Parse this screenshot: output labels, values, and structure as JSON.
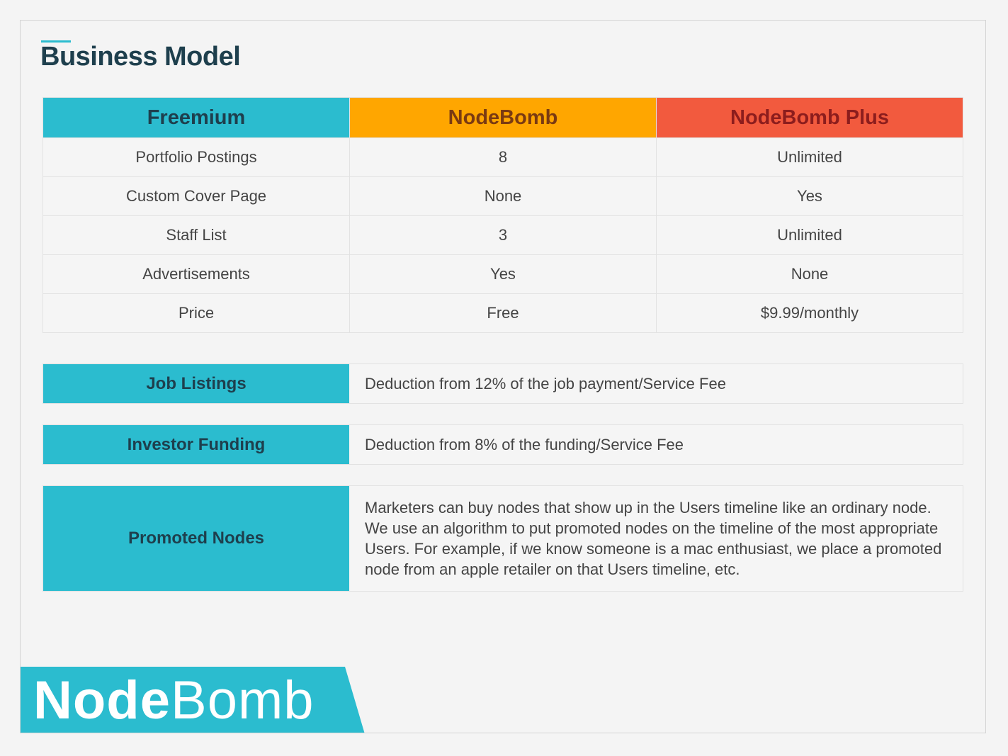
{
  "slide": {
    "title": "Business Model"
  },
  "pricing": {
    "headers": [
      "Freemium",
      "NodeBomb",
      "NodeBomb Plus"
    ],
    "rows": [
      [
        "Portfolio Postings",
        "8",
        "Unlimited"
      ],
      [
        "Custom Cover Page",
        "None",
        "Yes"
      ],
      [
        "Staff List",
        "3",
        "Unlimited"
      ],
      [
        "Advertisements",
        "Yes",
        "None"
      ],
      [
        "Price",
        "Free",
        "$9.99/monthly"
      ]
    ]
  },
  "revenue": [
    {
      "label": "Job Listings",
      "text": "Deduction from 12% of the job payment/Service Fee"
    },
    {
      "label": "Investor Funding",
      "text": "Deduction from 8% of the funding/Service Fee"
    },
    {
      "label": "Promoted Nodes",
      "text": "Marketers can buy nodes that show up in the Users timeline like an ordinary node. We use an algorithm to put promoted nodes on the timeline of the most appropriate Users. For example, if we know someone is a mac enthusiast, we place a promoted node from an apple retailer on that Users timeline, etc."
    }
  ],
  "logo": {
    "part1": "Node",
    "part2": "Bomb"
  },
  "colors": {
    "teal": "#2bbccf",
    "orange": "#ffa600",
    "red": "#f25a3e",
    "dark": "#1e3f4d"
  }
}
